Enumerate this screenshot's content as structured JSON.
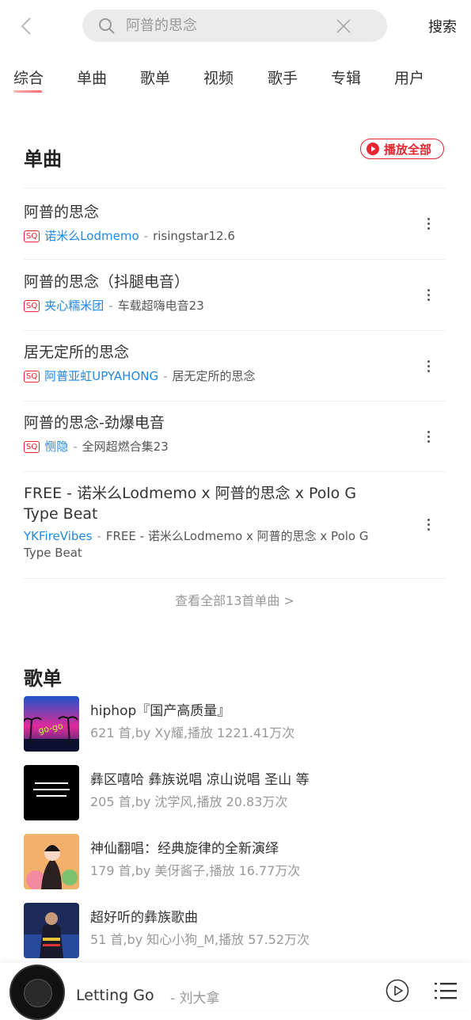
{
  "search": {
    "query": "阿普的思念",
    "button_label": "搜索"
  },
  "tabs": [
    {
      "label": "综合"
    },
    {
      "label": "单曲"
    },
    {
      "label": "歌单"
    },
    {
      "label": "视频"
    },
    {
      "label": "歌手"
    },
    {
      "label": "专辑"
    },
    {
      "label": "用户"
    }
  ],
  "songs_section": {
    "title": "单曲",
    "play_all_label": "播放全部",
    "quality_badge": "SQ",
    "songs": [
      {
        "title": "阿普的思念",
        "sq": true,
        "artist": "诺米么Lodmemo",
        "album": "risingstar12.6"
      },
      {
        "title": "阿普的思念（抖腿电音）",
        "sq": true,
        "artist": "夹心糯米团",
        "album": "车载超嗨电音23"
      },
      {
        "title": "居无定所的思念",
        "sq": true,
        "artist": "阿普亚虹UPYAHONG",
        "album": "居无定所的思念"
      },
      {
        "title": "阿普的思念-劲爆电音",
        "sq": true,
        "artist": "恻隐",
        "album": "全网超燃合集23"
      },
      {
        "title": "FREE - 诺米么Lodmemo x 阿普的思念 x Polo G Type Beat",
        "sq": false,
        "artist": "YKFireVibes",
        "album": "FREE - 诺米么Lodmemo x 阿普的思念 x Polo G Type Beat"
      }
    ],
    "see_all_label": "查看全部13首单曲 >"
  },
  "playlists_section": {
    "title": "歌单",
    "playlists": [
      {
        "name": "hiphop『国产高质量』",
        "info": "621 首,by Xy耀,播放 1221.41万次"
      },
      {
        "name": "彝区嘻哈 彝族说唱 凉山说唱 圣山 等",
        "info": "205 首,by 沈学风,播放 20.83万次"
      },
      {
        "name": "神仙翻唱：经典旋律的全新演绎",
        "info": "179 首,by 美伢酱子,播放 16.77万次"
      },
      {
        "name": "超好听的彝族歌曲",
        "info": "51 首,by 知心小狗_M,播放 57.52万次"
      }
    ]
  },
  "player": {
    "title": "Letting Go",
    "artist_prefix": "- ",
    "artist": "刘大拿"
  },
  "colors": {
    "accent": "#e6262e",
    "link": "#1e88e5"
  }
}
